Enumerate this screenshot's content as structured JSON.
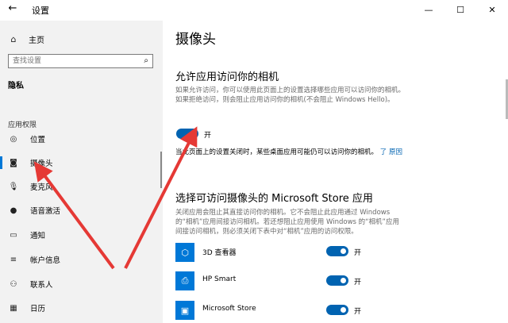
{
  "window": {
    "title": "设置",
    "back_glyph": "←",
    "minimize_glyph": "—",
    "maximize_glyph": "☐",
    "close_glyph": "✕"
  },
  "sidebar": {
    "home_label": "主页",
    "search_placeholder": "查找设置",
    "section_title": "隐私",
    "group_label": "应用权限",
    "items": [
      {
        "label": "位置",
        "icon": "location-icon"
      },
      {
        "label": "摄像头",
        "icon": "camera-icon",
        "active": true
      },
      {
        "label": "麦克风",
        "icon": "microphone-icon"
      },
      {
        "label": "语音激活",
        "icon": "voice-activation-icon"
      },
      {
        "label": "通知",
        "icon": "notification-icon"
      },
      {
        "label": "帐户信息",
        "icon": "account-info-icon"
      },
      {
        "label": "联系人",
        "icon": "contacts-icon"
      },
      {
        "label": "日历",
        "icon": "calendar-icon"
      }
    ]
  },
  "main": {
    "page_title": "摄像头",
    "allow_heading": "允许应用访问你的相机",
    "allow_desc": "如果允许访问，你可以使用此页面上的设置选择哪些应用可以访问你的相机。如果拒绝访问，则会阻止应用访问你的相机(不会阻止 Windows Hello)。",
    "allow_toggle_label": "开",
    "note_text": "当此页面上的设置关闭时，某些桌面应用可能仍可以访问你的相机。",
    "note_link_1": "了",
    "note_link_2": "原因",
    "store_heading": "选择可访问摄像头的 Microsoft Store 应用",
    "store_desc": "关闭应用会阻止其直接访问你的相机。它不会阻止此应用通过 Windows 的“相机”应用间接访问相机。若还想阻止应用使用 Windows 的“相机”应用间接访问相机，则必须关闭下表中对“相机”应用的访问权限。",
    "apps": [
      {
        "name": "3D 查看器",
        "toggle": "开",
        "icon": "3d-viewer-icon"
      },
      {
        "name": "HP Smart",
        "toggle": "开",
        "icon": "hp-smart-icon"
      },
      {
        "name": "Microsoft Store",
        "toggle": "开",
        "icon": "microsoft-store-icon"
      }
    ]
  },
  "colors": {
    "accent": "#0063b1",
    "arrow": "#e53935",
    "sidebar_bg": "#f2f2f2"
  }
}
